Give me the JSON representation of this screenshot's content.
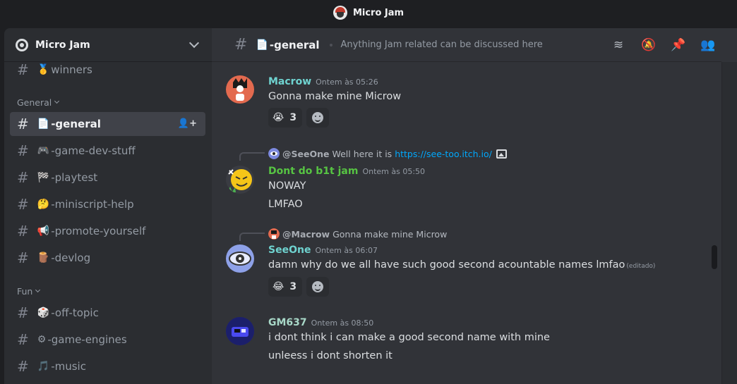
{
  "window": {
    "title": "Micro Jam"
  },
  "guild": {
    "name": "Micro Jam"
  },
  "sidebar": {
    "top_item": {
      "emoji": "🥇",
      "label": "winners"
    },
    "categories": [
      {
        "label": "General"
      },
      {
        "label": "Fun"
      }
    ],
    "general_channels": [
      {
        "emoji": "📄",
        "label": "-general",
        "active": true
      },
      {
        "emoji": "🎮",
        "label": "-game-dev-stuff"
      },
      {
        "emoji": "🏁",
        "label": "-playtest"
      },
      {
        "emoji": "🤔",
        "label": "-miniscript-help"
      },
      {
        "emoji": "📢",
        "label": "-promote-yourself"
      },
      {
        "emoji": "🪵",
        "label": "-devlog"
      }
    ],
    "fun_channels": [
      {
        "emoji": "🎲",
        "label": "-off-topic"
      },
      {
        "emoji": "⚙",
        "label": "-game-engines"
      },
      {
        "emoji": "🎵",
        "label": "-music"
      }
    ]
  },
  "channel_header": {
    "emoji": "📄",
    "name": "-general",
    "topic": "Anything Jam related can be discussed here"
  },
  "messages": [
    {
      "author": "Macrow",
      "author_color": "#6fd3d0",
      "timestamp": "Ontem às 05:26",
      "lines": [
        "Gonna make mine Microw"
      ],
      "reaction": {
        "emoji": "😭",
        "count": "3"
      }
    },
    {
      "reply": {
        "mention": "@SeeOne",
        "text": "Well here it is",
        "link": "https://see-too.itch.io/"
      },
      "author": "Dont do b1t jam",
      "author_color": "#57c443",
      "timestamp": "Ontem às 05:50",
      "lines": [
        "NOWAY",
        "LMFAO"
      ]
    },
    {
      "reply": {
        "mention": "@Macrow",
        "text": "Gonna make mine Microw"
      },
      "author": "SeeOne",
      "author_color": "#6fd3d0",
      "timestamp": "Ontem às 06:07",
      "lines": [
        "damn why do we all have such good second acountable names lmfao"
      ],
      "edited": "(editado)",
      "reaction": {
        "emoji": "😂",
        "count": "3"
      }
    },
    {
      "author": "GM637",
      "author_color": "#a8d8c8",
      "timestamp": "Ontem às 08:50",
      "lines": [
        "i dont think i can make a good second name with mine",
        "unleess i dont shorten it"
      ]
    }
  ],
  "colors": {
    "active_channel_bg": "#404249",
    "link": "#00a8fc",
    "sidebar_bg": "#2b2d31",
    "chat_bg": "#313338"
  }
}
